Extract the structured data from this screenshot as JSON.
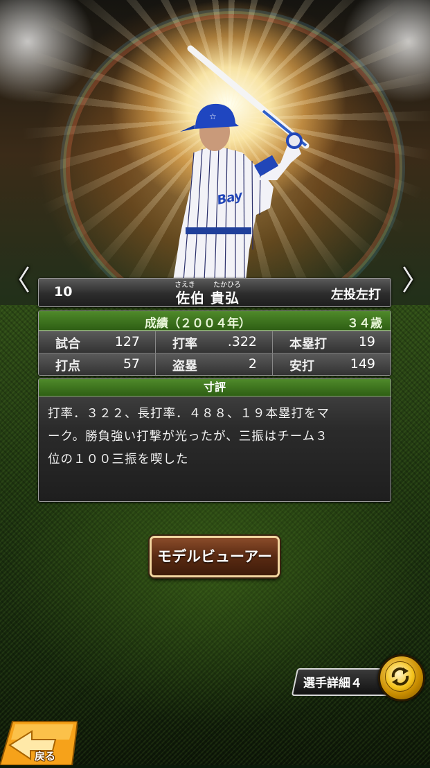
{
  "player": {
    "number": "10",
    "name": "佐伯 貴弘",
    "ruby_first": "さえき",
    "ruby_last": "たかひろ",
    "throw_bat": "左投左打"
  },
  "nav": {
    "prev": "〈",
    "next": "〉"
  },
  "stats": {
    "header_season": "成績（２００４年）",
    "header_age": "３４歳",
    "rows": [
      [
        {
          "label": "試合",
          "value": "127"
        },
        {
          "label": "打率",
          "value": ".322"
        },
        {
          "label": "本塁打",
          "value": "19"
        }
      ],
      [
        {
          "label": "打点",
          "value": "57"
        },
        {
          "label": "盗塁",
          "value": "2"
        },
        {
          "label": "安打",
          "value": "149"
        }
      ]
    ]
  },
  "comment": {
    "header": "寸評",
    "lines": [
      "打率．３２２、長打率．４８８、１９本塁打をマ",
      "ーク。勝負強い打撃が光ったが、三振はチーム３",
      "位の１００三振を喫した"
    ]
  },
  "buttons": {
    "model_viewer": "モデルビューアー",
    "player_detail": "選手詳細４",
    "back": "戻る"
  },
  "colors": {
    "header_green": "#3e7420",
    "button_brown": "#5a2a12",
    "button_border": "#f2d6a0",
    "swap_gold": "#f4c21a",
    "back_orange": "#f6a21a"
  },
  "icons": {
    "prev": "chevron-left-icon",
    "next": "chevron-right-icon",
    "swap": "swap-arrows-icon",
    "back": "back-arrow-icon"
  }
}
